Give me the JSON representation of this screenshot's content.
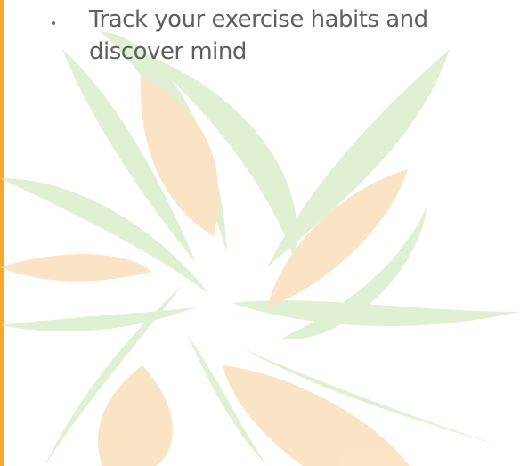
{
  "colors": {
    "edge_bar": "#f7a72c",
    "leaf_green": "#d8ecc6",
    "leaf_orange": "#fbdcb7",
    "text": "#5f5f5f",
    "bullet": "#6f6f6f"
  },
  "bullets": [
    {
      "text": "Track your exercise habits and discover mind"
    }
  ]
}
